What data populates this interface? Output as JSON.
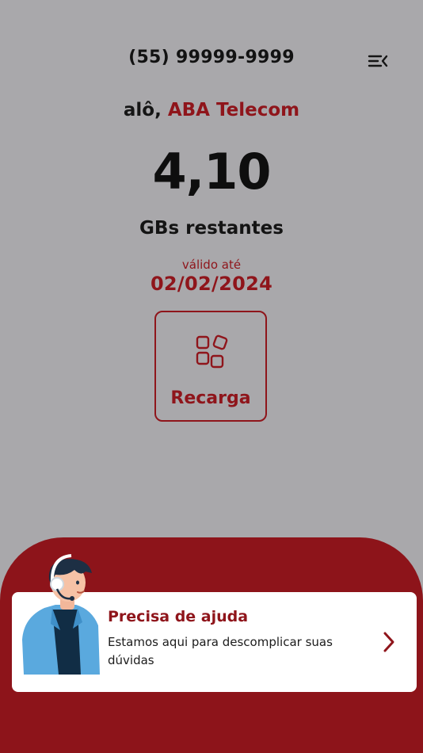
{
  "header": {
    "phone_number": "(55) 99999-9999",
    "menu_icon": "menu-collapse-icon"
  },
  "greeting": {
    "prefix": "alô,",
    "brand": "ABA Telecom"
  },
  "balance": {
    "value": "4,10",
    "unit_label": "GBs restantes",
    "valid_label": "válido até",
    "valid_date": "02/02/2024"
  },
  "recharge": {
    "label": "Recarga",
    "icon": "apps-grid-icon"
  },
  "help": {
    "title": "Precisa de ajuda",
    "description": "Estamos aqui para descomplicar suas dúvidas",
    "arrow_icon": "chevron-right-icon",
    "illustration": "support-agent-illustration"
  },
  "colors": {
    "background": "#a9a8ab",
    "accent": "#8f151b",
    "panel": "#8d141a",
    "card": "#ffffff"
  }
}
